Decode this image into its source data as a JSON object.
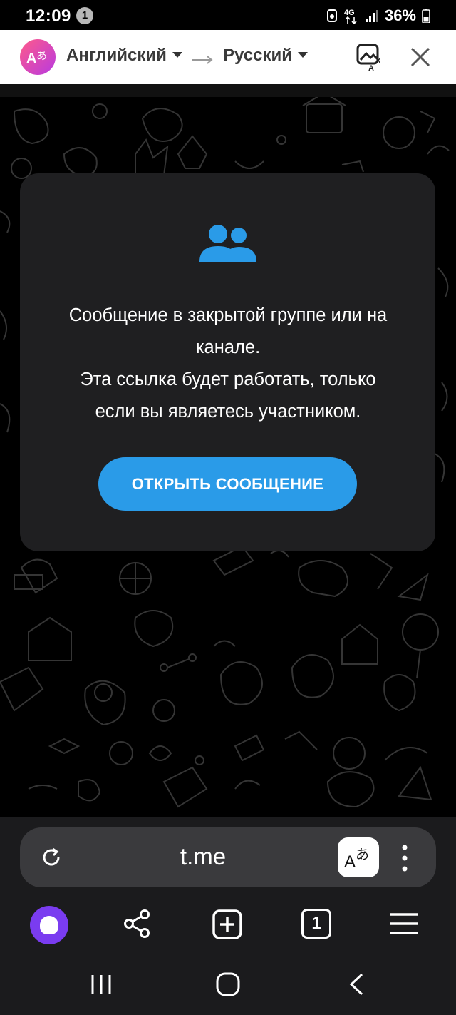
{
  "status_bar": {
    "time": "12:09",
    "notification_count": "1",
    "network": "4G",
    "battery": "36%"
  },
  "translate_bar": {
    "source_language": "Английский",
    "target_language": "Русский",
    "icons": [
      "translate-logo-icon",
      "arrow-right-icon",
      "image-translate-icon",
      "close-icon"
    ]
  },
  "card": {
    "icon": "group-icon",
    "line1": "Сообщение в закрытой группе или на",
    "line2": "канале.",
    "line3": "Эта ссылка будет работать, только",
    "line4": "если вы являетесь участником.",
    "button_label": "ОТКРЫТЬ СООБЩЕНИЕ"
  },
  "browser": {
    "url": "t.me",
    "tabs_count": "1",
    "icons": [
      "reload-icon",
      "translate-page-icon",
      "more-menu-icon",
      "alice-icon",
      "share-icon",
      "new-tab-icon",
      "tabs-icon",
      "hamburger-menu-icon"
    ]
  },
  "navigation": {
    "icons": [
      "recent-apps-icon",
      "home-icon",
      "back-icon"
    ]
  },
  "colors": {
    "accent": "#2a9be8",
    "card_bg": "#1f1f21",
    "alice": "#7a3cf0"
  }
}
